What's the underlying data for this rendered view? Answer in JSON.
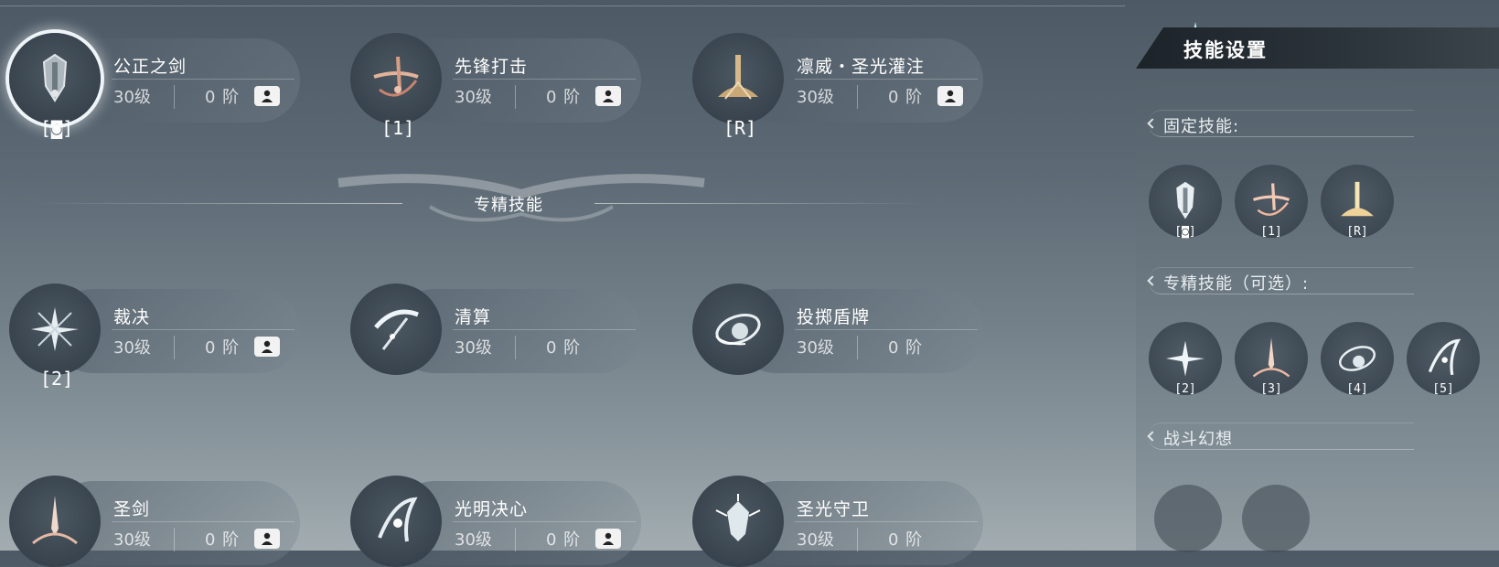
{
  "fixed_skills": [
    {
      "name": "公正之剑",
      "level": "30级",
      "rank": "0 阶",
      "key": "[◙]",
      "has_badge": true,
      "selected": true,
      "icon": "justice-sword-icon"
    },
    {
      "name": "先锋打击",
      "level": "30级",
      "rank": "0 阶",
      "key": "[1]",
      "has_badge": true,
      "selected": false,
      "icon": "vanguard-strike-icon"
    },
    {
      "name": "凛威・圣光灌注",
      "level": "30级",
      "rank": "0 阶",
      "key": "[R]",
      "has_badge": true,
      "selected": false,
      "icon": "holy-light-icon"
    }
  ],
  "spec_title": "专精技能",
  "spec_skills": [
    {
      "name": "裁决",
      "level": "30级",
      "rank": "0 阶",
      "key": "[2]",
      "has_badge": true,
      "icon": "judgment-icon"
    },
    {
      "name": "清算",
      "level": "30级",
      "rank": "0 阶",
      "key": "",
      "has_badge": false,
      "icon": "reckoning-icon"
    },
    {
      "name": "投掷盾牌",
      "level": "30级",
      "rank": "0 阶",
      "key": "",
      "has_badge": false,
      "icon": "shield-throw-icon"
    },
    {
      "name": "圣剑",
      "level": "30级",
      "rank": "0 阶",
      "key": "",
      "has_badge": true,
      "icon": "holy-sword-icon"
    },
    {
      "name": "光明决心",
      "level": "30级",
      "rank": "0 阶",
      "key": "",
      "has_badge": true,
      "icon": "bright-resolve-icon"
    },
    {
      "name": "圣光守卫",
      "level": "30级",
      "rank": "0 阶",
      "key": "",
      "has_badge": false,
      "icon": "holy-guard-icon"
    }
  ],
  "panel": {
    "title": "技能设置",
    "fixed_label": "固定技能:",
    "spec_label": "专精技能（可选）:",
    "fantasy_label": "战斗幻想",
    "fixed_slots": [
      {
        "key": "[◙]",
        "icon": "justice-sword-icon"
      },
      {
        "key": "[1]",
        "icon": "vanguard-strike-icon"
      },
      {
        "key": "[R]",
        "icon": "holy-light-icon"
      }
    ],
    "spec_slots": [
      {
        "key": "[2]",
        "icon": "judgment-icon"
      },
      {
        "key": "[3]",
        "icon": "holy-sword-icon"
      },
      {
        "key": "[4]",
        "icon": "shield-throw-icon"
      },
      {
        "key": "[5]",
        "icon": "bright-resolve-icon"
      }
    ]
  }
}
